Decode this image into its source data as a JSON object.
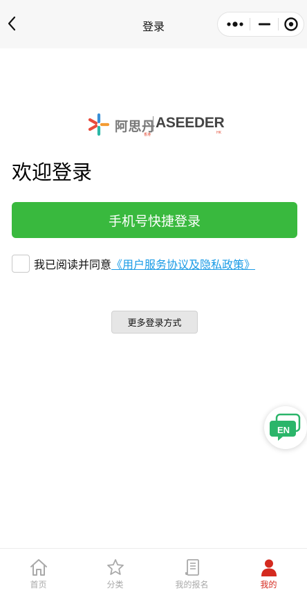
{
  "navbar": {
    "title": "登录",
    "back_icon": "chevron-left-icon",
    "capsule": {
      "more_icon": "more-dots-icon",
      "minimize_icon": "minimize-icon",
      "close_icon": "target-close-icon"
    }
  },
  "logo": {
    "cn_name": "阿思丹",
    "cn_sub": "香港",
    "en_name": "ASEEDER",
    "en_sub": "HK",
    "colors": {
      "red": "#e94b3c",
      "orange": "#f39c34",
      "teal": "#2bb7a6",
      "blue": "#3a8fd6"
    }
  },
  "main": {
    "welcome": "欢迎登录",
    "phone_login_label": "手机号快捷登录",
    "agreement_prefix": "我已阅读并同意",
    "agreement_link": "《用户服务协议及隐私政策》",
    "more_login_label": "更多登录方式"
  },
  "fab": {
    "label": "EN",
    "icon": "translate-chat-icon"
  },
  "tabbar": {
    "items": [
      {
        "label": "首页",
        "icon": "home-icon",
        "active": false
      },
      {
        "label": "分类",
        "icon": "star-icon",
        "active": false
      },
      {
        "label": "我的报名",
        "icon": "document-icon",
        "active": false
      },
      {
        "label": "我的",
        "icon": "user-icon",
        "active": true
      }
    ]
  },
  "colors": {
    "primary_green": "#39b93e",
    "link_blue": "#1a9be6",
    "active_red": "#d42a1f",
    "inactive_gray": "#a9a9a9"
  }
}
